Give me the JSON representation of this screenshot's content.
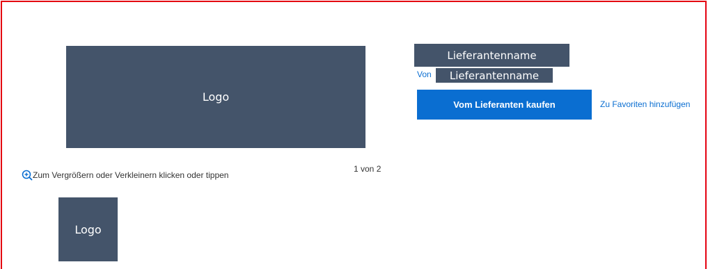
{
  "gallery": {
    "main_logo_label": "Logo",
    "thumbnail_logo_label": "Logo",
    "zoom_hint": "Zum Vergrößern oder Verkleinern klicken oder tippen",
    "pager": "1 von 2",
    "zoom_icon": "zoom-in-icon"
  },
  "product": {
    "supplier_title": "Lieferantenname",
    "von_label": "Von",
    "supplier_name": "Lieferantenname",
    "buy_button_label": "Vom Lieferanten kaufen",
    "favorites_link": "Zu Favoriten hinzufügen"
  },
  "colors": {
    "frame_border": "#e4000f",
    "placeholder_fill": "#44546a",
    "accent": "#0a6ed1"
  }
}
